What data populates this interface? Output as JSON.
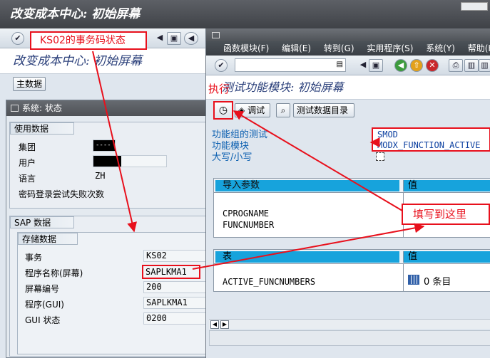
{
  "back_window": {
    "title": "改变成本中心: 初始屏幕",
    "subtitle": "改变成本中心: 初始屏幕",
    "master_data_button": "主数据",
    "status_popup": {
      "title": "系统: 状态",
      "usage_group": {
        "title": "使用数据",
        "rows": [
          {
            "label": "集团",
            "value": "----"
          },
          {
            "label": "用户",
            "value": ""
          },
          {
            "label": "语言",
            "value": "ZH"
          },
          {
            "label": "密码登录尝试失败次数",
            "value": ""
          }
        ]
      },
      "sap_group": {
        "title": "SAP 数据",
        "storage_title": "存储数据",
        "rows": [
          {
            "label": "事务",
            "value": "KS02"
          },
          {
            "label": "程序名称(屏幕)",
            "value": "SAPLKMA1"
          },
          {
            "label": "屏幕编号",
            "value": "200"
          },
          {
            "label": "程序(GUI)",
            "value": "SAPLKMA1"
          },
          {
            "label": "GUI 状态",
            "value": "0200"
          }
        ]
      }
    }
  },
  "front_window": {
    "menu": [
      "函数模块(F)",
      "编辑(E)",
      "转到(G)",
      "实用程序(S)",
      "系统(Y)",
      "帮助(H)"
    ],
    "title": "测试功能模块: 初始屏幕",
    "toolbar": {
      "debug_label": "调试",
      "test_dir_label": "测试数据目录"
    },
    "fields": [
      {
        "label": "功能组的测试",
        "value": "SMOD"
      },
      {
        "label": "功能模块",
        "value": "MODX_FUNCTION_ACTIVE"
      },
      {
        "label": "大写/小写",
        "value": ""
      }
    ],
    "import_table": {
      "header": "导入参数",
      "value_header": "值",
      "params": [
        "CPROGNAME",
        "FUNCNUMBER"
      ]
    },
    "tables_table": {
      "header": "表",
      "value_header": "值",
      "rows": [
        {
          "name": "ACTIVE_FUNCNUMBERS",
          "count": "0 条目"
        }
      ]
    }
  },
  "annotations": {
    "ks02_label": "KS02的事务码状态",
    "execute_label": "执行",
    "fill_here": "填写到这里"
  },
  "colors": {
    "accent_red": "#e8101c",
    "sap_blue": "#0b6fc4",
    "title_dark": "#4a4d52"
  }
}
